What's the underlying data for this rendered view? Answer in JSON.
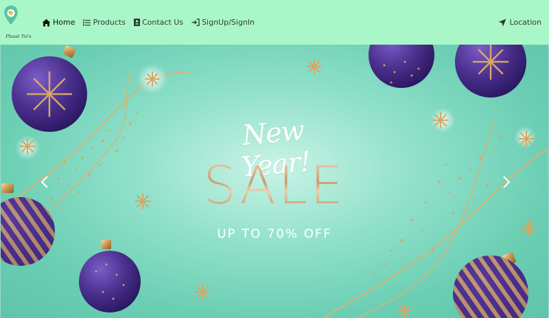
{
  "brand": {
    "logo_text": "Plaast Toi's",
    "navbar_color": "#a9f7c8",
    "pin_color": "#57c3a5"
  },
  "nav": {
    "items": [
      {
        "label": "Home",
        "icon": "home-icon",
        "active": true
      },
      {
        "label": "Products",
        "icon": "list-icon",
        "active": false
      },
      {
        "label": "Contact Us",
        "icon": "contact-card-icon",
        "active": false
      },
      {
        "label": "SignUp/SignIn",
        "icon": "sign-in-icon",
        "active": false
      }
    ],
    "location": {
      "label": "Location",
      "icon": "location-arrow-icon"
    }
  },
  "hero": {
    "headline": "New Year!",
    "sale": "SALE",
    "subline": "UP TO 70% OFF",
    "background_color": "#6ccfb4",
    "ornament_purple": "#4a2f8c",
    "gold": "#d4a865",
    "prev_icon": "chevron-left-icon",
    "next_icon": "chevron-right-icon"
  }
}
